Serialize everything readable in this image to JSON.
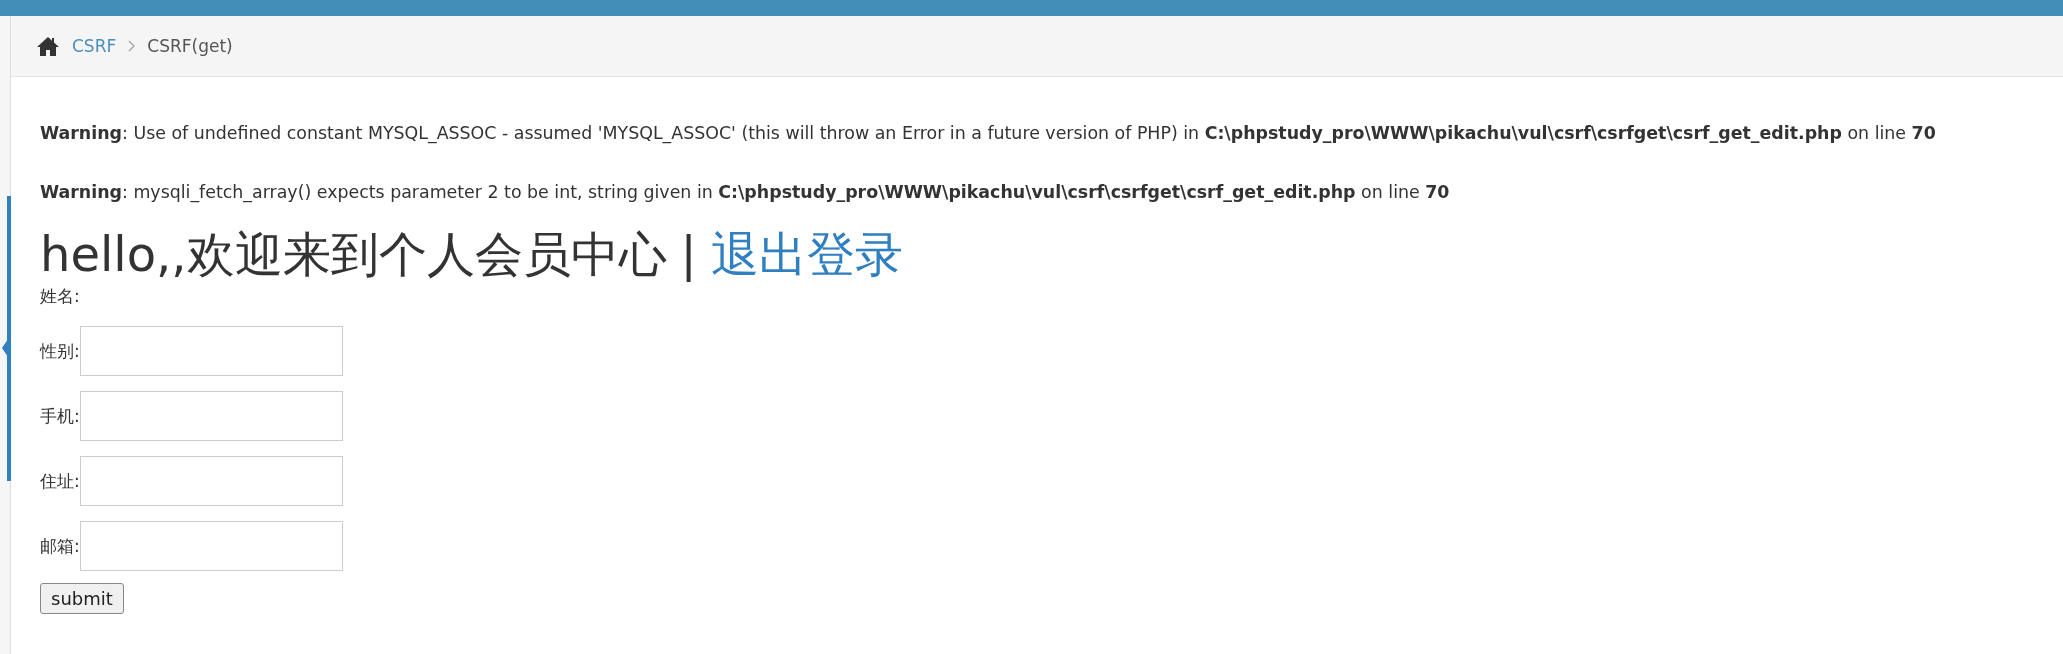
{
  "breadcrumb": [
    {
      "label": "CSRF",
      "kind": "link"
    },
    {
      "label": "CSRF(get)",
      "kind": "current"
    }
  ],
  "warnings": [
    "**Warning**: Use of undefined constant MYSQL_ASSOC - assumed 'MYSQL_ASSOC' (this will throw an Error in a future version of PHP) in **C:\\phpstudy_pro\\WWW\\pikachu\\vul\\csrf\\csrfget\\csrf_get_edit.php** on line **70**",
    "**Warning**: mysqli_fetch_array() expects parameter 2 to be int, string given in **C:\\phpstudy_pro\\WWW\\pikachu\\vul\\csrf\\csrfget\\csrf_get_edit.php** on line **70**"
  ],
  "heading": {
    "text": "hello,,欢迎来到个人会员中心",
    "separator": "|",
    "logout": "退出登录"
  },
  "form": {
    "fields": [
      {
        "label": "姓名:",
        "kind": "text"
      },
      {
        "label": "性别:",
        "kind": "input"
      },
      {
        "label": "手机:",
        "kind": "input"
      },
      {
        "label": "住址:",
        "kind": "input"
      },
      {
        "label": "邮箱:",
        "kind": "input"
      }
    ],
    "submit": "submit"
  }
}
